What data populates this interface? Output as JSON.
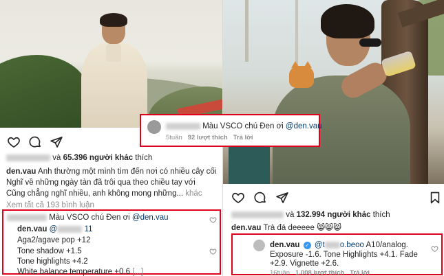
{
  "left_post": {
    "likes_prefix": "và",
    "likes_count": "65.396 người khác",
    "likes_suffix": "thích",
    "caption_user": "den.vau",
    "caption_line1": "Anh thường một mình tìm đến nơi có nhiều cây cối",
    "caption_line2": "Nghĩ về những ngày tàn đã trôi qua theo chiều tay với",
    "caption_line3": "Cũng chẳng nghĩ nhiều, anh không mong những...",
    "more_label": "khác",
    "view_all_comments": "Xem tất cả 193 bình luận",
    "comment1_text": "Màu VSCO chú Đen ơi",
    "comment1_mention": "@den.vau",
    "reply_user": "den.vau",
    "reply_mention_prefix": "@",
    "reply_mention_suffix": "11",
    "reply_line1": "Aga2/agave pop +12",
    "reply_line2": "Tone shadow +1.5",
    "reply_line3": "Tone highlights +4.2",
    "reply_line4": "White balance temperature +0.6",
    "reply_more": "[...]"
  },
  "popup_comment": {
    "text": "Màu VSCO chú Đen ơi",
    "mention": "@den.vau",
    "time": "5tuần",
    "likes": "92 lượt thích",
    "reply_label": "Trả lời"
  },
  "right_post": {
    "likes_prefix": "và",
    "likes_count": "132.994 người khác",
    "likes_suffix": "thích",
    "caption_user": "den.vau",
    "caption_text": "Trà đá deeeee",
    "caption_emoji": "😸😸😸",
    "reply_user": "den.vau",
    "reply_mention_prefix": "@t",
    "reply_mention_suffix": "o.beoo",
    "reply_line1": "A10/analog.",
    "reply_line2": "Exposure -1.6. Tone Highlights +4.1. Fade",
    "reply_line3": "+2.9. Vignette +2.6.",
    "reply_time": "16tuần",
    "reply_likes": "1.008 lượt thích",
    "reply_label": "Trả lời"
  },
  "icons": [
    "heart-icon",
    "comment-icon",
    "share-icon",
    "bookmark-icon",
    "verified-icon"
  ],
  "colors": {
    "highlight_box": "#e0001b",
    "mention": "#00376b",
    "muted": "#8e8e8e",
    "verified": "#3897f0"
  }
}
